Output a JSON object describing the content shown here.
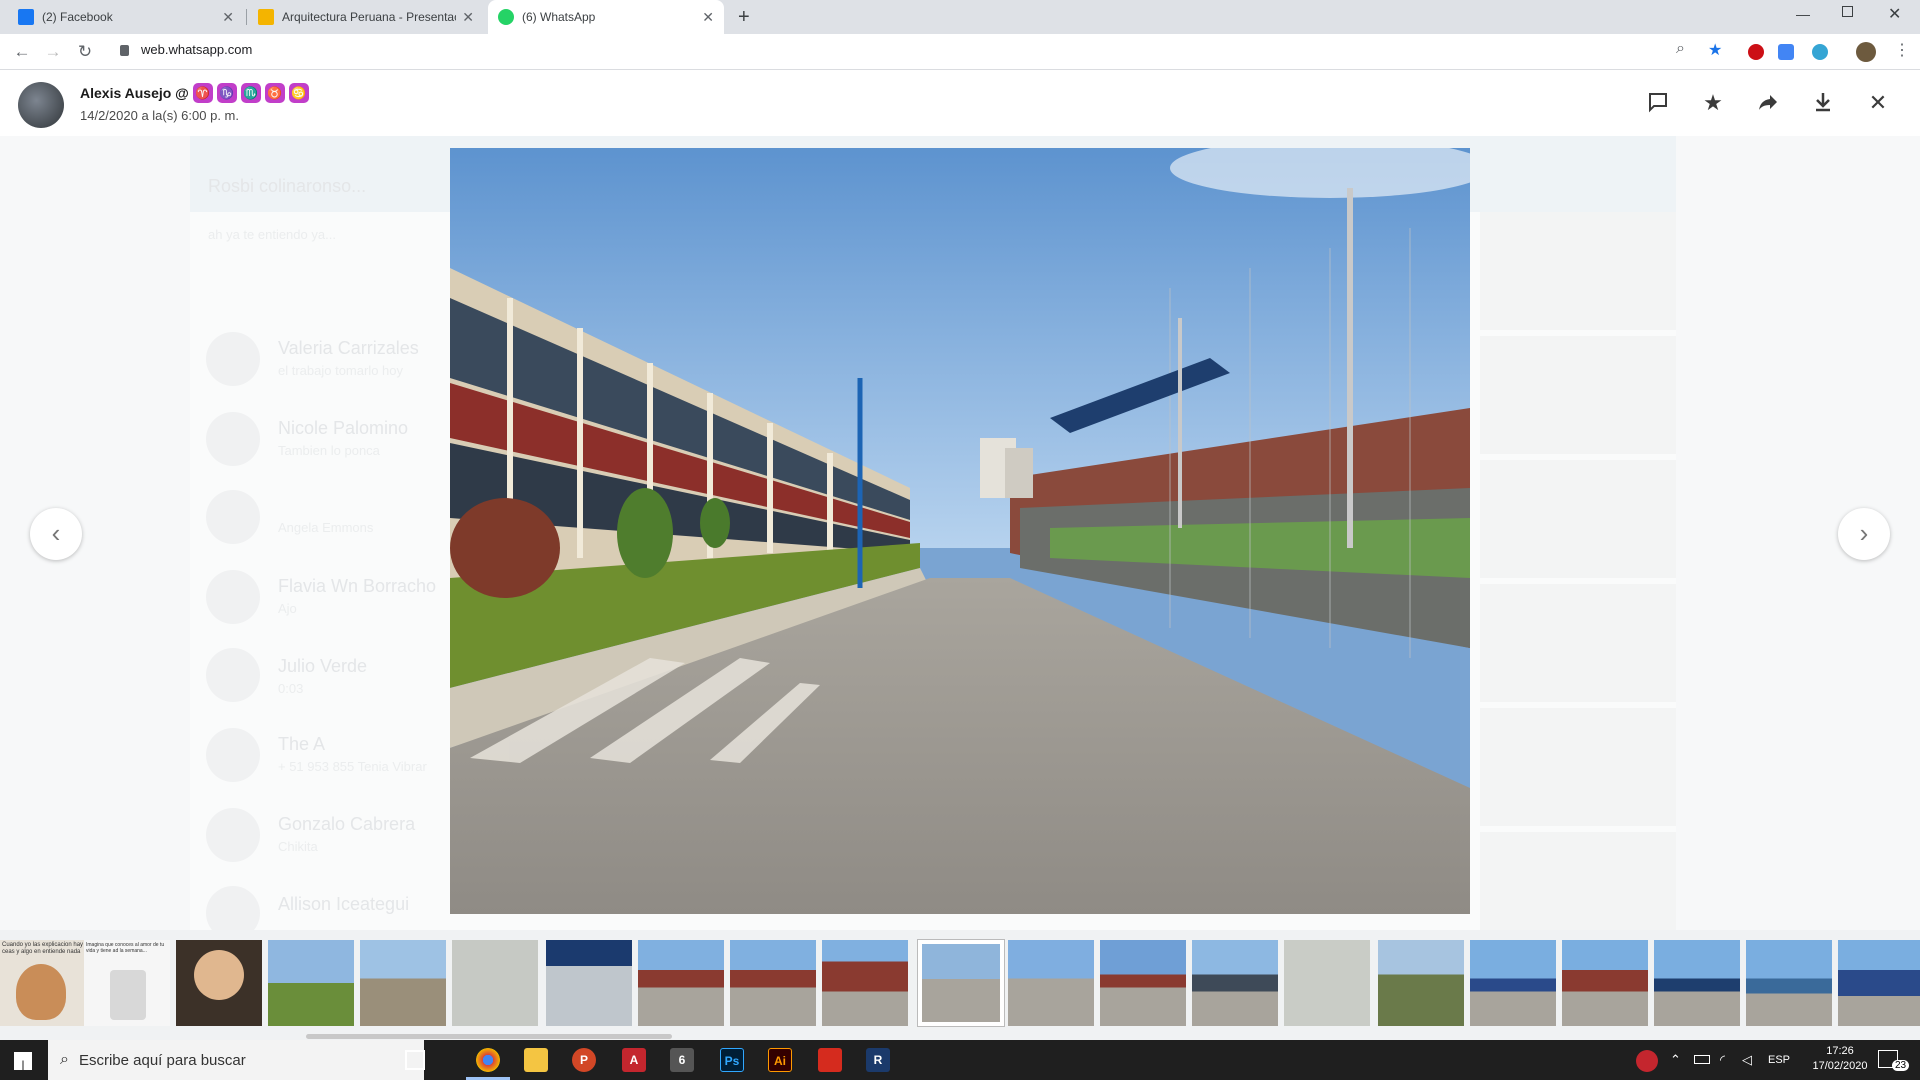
{
  "browser": {
    "tabs": [
      {
        "title": "(2) Facebook",
        "favicon_color": "#1877f2"
      },
      {
        "title": "Arquitectura Peruana - Presentac",
        "favicon_color": "#f4b400"
      },
      {
        "title": "(6) WhatsApp",
        "favicon_color": "#25d366"
      }
    ],
    "new_tab": "+",
    "url": "web.whatsapp.com"
  },
  "viewer": {
    "sender_name": "Alexis Ausejo @",
    "sender_emojis": [
      "♈",
      "♑",
      "♏",
      "♉",
      "♋"
    ],
    "datetime": "14/2/2020 a la(s) 6:00 p. m.",
    "icons": [
      "reply-icon",
      "star-icon",
      "forward-icon",
      "download-icon",
      "close-icon"
    ]
  },
  "background_chats": [
    {
      "name": "Rosbi colinaronso...",
      "preview": "ah ya te entiendo ya..."
    },
    {
      "name": "Valeria Carrizales",
      "preview": "el trabajo tomarlo hoy"
    },
    {
      "name": "Nicole Palomino",
      "preview": "Tambien lo ponca"
    },
    {
      "name": "",
      "preview": "Angela Emmons"
    },
    {
      "name": "Flavia Wn Borracho",
      "preview": "Ajo"
    },
    {
      "name": "Julio Verde",
      "preview": "0:03"
    },
    {
      "name": "The A",
      "preview": "+ 51 953 855 Tenia Vibrar"
    },
    {
      "name": "Gonzalo Cabrera",
      "preview": "Chikita"
    },
    {
      "name": "Allison Iceategui",
      "preview": ""
    }
  ],
  "thumbnail_text": {
    "t1": "Cuando yo las explicacion hay ceas y algo en entiende nada",
    "t2": "Imagina que conoces al amor de tu vida y tiene ad la semana..."
  },
  "taskbar": {
    "search_placeholder": "Escribe aquí para buscar",
    "apps": [
      {
        "name": "chrome",
        "color": "#db4437",
        "label": ""
      },
      {
        "name": "file-explorer",
        "color": "#f4c542",
        "label": ""
      },
      {
        "name": "powerpoint",
        "color": "#d24726",
        "label": "P"
      },
      {
        "name": "autocad",
        "color": "#c4262e",
        "label": "A"
      },
      {
        "name": "app-badge",
        "color": "#555",
        "label": "6"
      },
      {
        "name": "photoshop",
        "color": "#001e36",
        "label": "Ps"
      },
      {
        "name": "illustrator",
        "color": "#330000",
        "label": "Ai"
      },
      {
        "name": "sketchup",
        "color": "#d52b1e",
        "label": ""
      },
      {
        "name": "revit",
        "color": "#1b3a6b",
        "label": "R"
      }
    ],
    "language": "ESP",
    "time": "17:26",
    "date": "17/02/2020",
    "notifications": "23"
  }
}
